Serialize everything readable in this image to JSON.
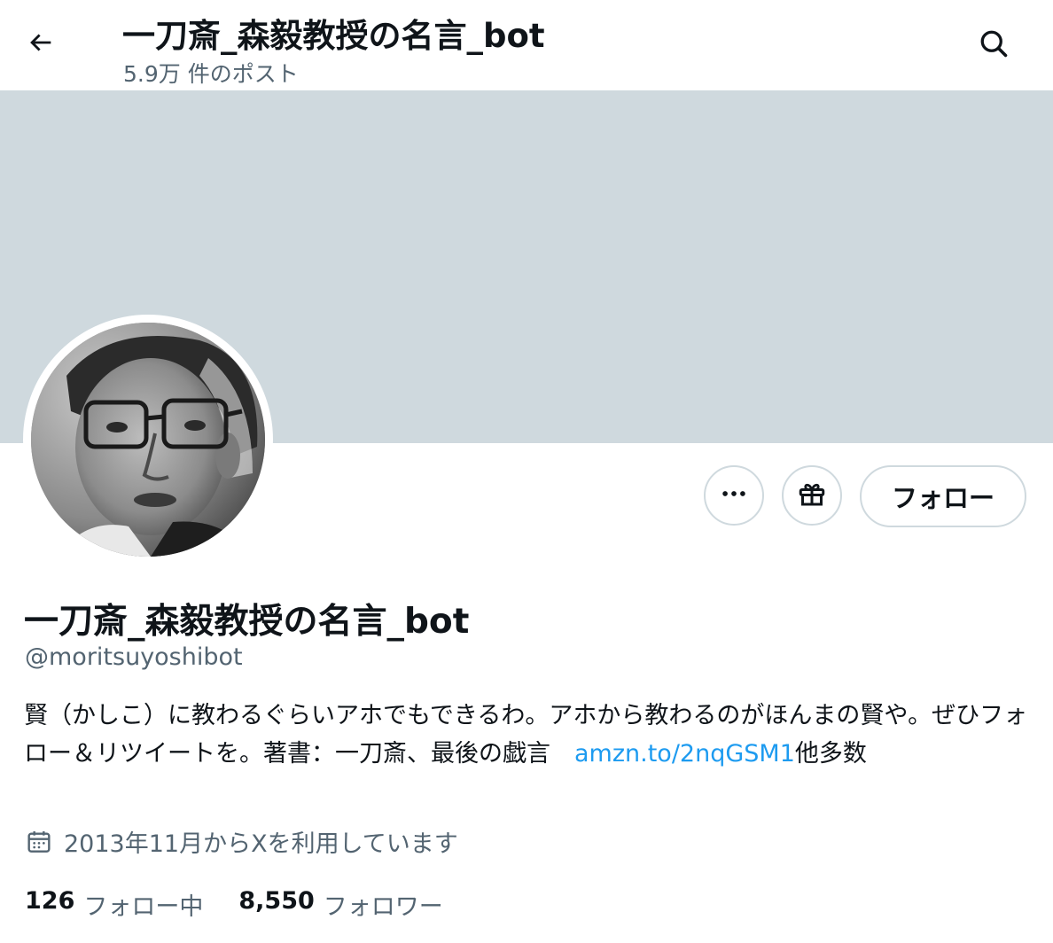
{
  "header": {
    "title": "一刀斎_森毅教授の名言_bot",
    "post_count": "5.9万 件のポスト"
  },
  "actions": {
    "follow_label": "フォロー"
  },
  "profile": {
    "display_name": "一刀斎_森毅教授の名言_bot",
    "handle": "@moritsuyoshibot",
    "bio_text": "賢（かしこ）に教わるぐらいアホでもできるわ。アホから教わるのがほんまの賢や。ぜひフォロー＆リツイートを。著書：一刀斎、最後の戯言　",
    "bio_link": "amzn.to/2nqGSM1",
    "bio_suffix": "他多数",
    "joined": "2013年11月からXを利用しています"
  },
  "stats": {
    "following_count": "126",
    "following_label": "フォロー中",
    "followers_count": "8,550",
    "followers_label": "フォロワー"
  },
  "colors": {
    "banner": "#cfd9de",
    "link": "#1d9bf0",
    "secondary_text": "#536471",
    "primary_text": "#0f1419"
  },
  "icons": {
    "back": "arrow-left-icon",
    "search": "search-icon",
    "more": "more-horizontal-icon",
    "gift": "gift-icon",
    "calendar": "calendar-icon"
  }
}
